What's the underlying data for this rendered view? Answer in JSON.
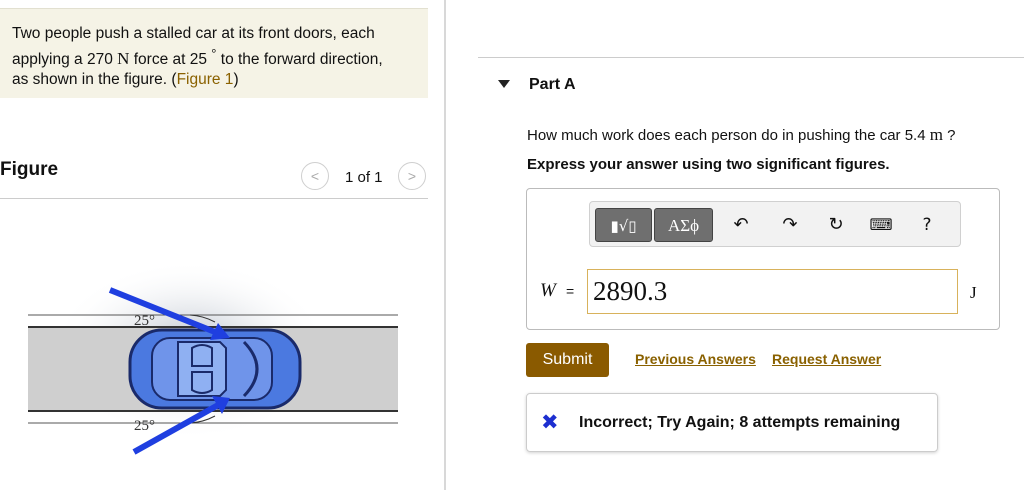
{
  "problem": {
    "text_1": "Two people push a stalled car at its front doors, each",
    "text_2a": "applying a 270 ",
    "force_unit": "N",
    "text_2b": " force at 25 ",
    "degree": "°",
    "text_2c": " to the forward direction,",
    "text_3a": "as shown in the figure. (",
    "figure_link": "Figure 1",
    "text_3b": ")"
  },
  "figure_panel": {
    "title": "Figure",
    "prev_icon": "chevron-left-icon",
    "next_icon": "chevron-right-icon",
    "prev_glyph": "<",
    "next_glyph": ">",
    "pager_text": "1 of 1",
    "angle_top": "25°",
    "angle_bottom": "25°",
    "colors": {
      "road": "#cfcfcf",
      "car": "#4b79e0",
      "arrow": "#1f3fe0"
    }
  },
  "part": {
    "title": "Part A",
    "question_a": "How much work does each person do in pushing the car 5.4 ",
    "question_unit": "m",
    "question_b": " ?",
    "instruction": "Express your answer using two significant figures."
  },
  "toolbar": {
    "templates_label": "▮√▯",
    "symbols_label": "ΑΣϕ",
    "undo_glyph": "↶",
    "redo_glyph": "↷",
    "reset_glyph": "↻",
    "keyboard_glyph": "⌨",
    "help_glyph": "?"
  },
  "answer": {
    "variable": "W",
    "equals": "=",
    "value": "2890.3",
    "unit": "J"
  },
  "actions": {
    "submit_label": "Submit",
    "previous_answers": "Previous Answers",
    "request_answer": "Request Answer"
  },
  "feedback": {
    "icon": "x-icon",
    "icon_glyph": "✖",
    "text": "Incorrect; Try Again; 8 attempts remaining"
  }
}
